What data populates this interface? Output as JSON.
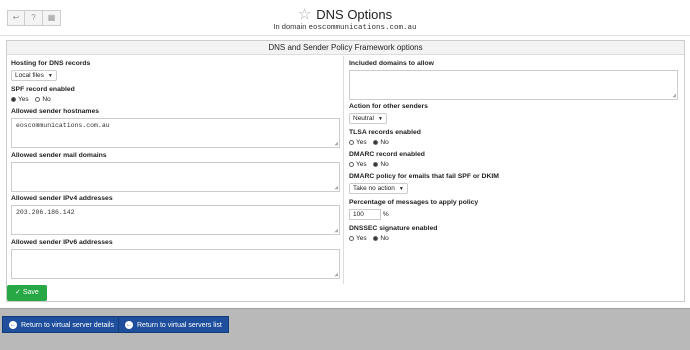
{
  "header": {
    "back_icon": "back-arrow-icon",
    "help_icon": "help-icon",
    "grid_icon": "grid-icon",
    "title": "DNS Options",
    "subtitle_prefix": "In domain ",
    "domain": "eoscommunications.com.au"
  },
  "panel": {
    "heading": "DNS and Sender Policy Framework options"
  },
  "left": {
    "hosting": {
      "label": "Hosting for DNS records",
      "value": "Local files"
    },
    "spf": {
      "label": "SPF record enabled",
      "yes": "Yes",
      "no": "No",
      "selected": "Yes"
    },
    "hostnames": {
      "label": "Allowed sender hostnames",
      "value": "eoscommunications.com.au"
    },
    "mail_domains": {
      "label": "Allowed sender mail domains",
      "value": ""
    },
    "ipv4": {
      "label": "Allowed sender IPv4 addresses",
      "value": "203.206.186.142"
    },
    "ipv6": {
      "label": "Allowed sender IPv6 addresses",
      "value": ""
    }
  },
  "right": {
    "included": {
      "label": "Included domains to allow",
      "value": ""
    },
    "other_senders": {
      "label": "Action for other senders",
      "value": "Neutral"
    },
    "tlsa": {
      "label": "TLSA records enabled",
      "yes": "Yes",
      "no": "No",
      "selected": "No"
    },
    "dmarc": {
      "label": "DMARC record enabled",
      "yes": "Yes",
      "no": "No",
      "selected": "No"
    },
    "dmarc_policy": {
      "label": "DMARC policy for emails that fail SPF or DKIM",
      "value": "Take no action"
    },
    "percentage": {
      "label": "Percentage of messages to apply policy",
      "value": "100",
      "unit": "%"
    },
    "dnssec": {
      "label": "DNSSEC signature enabled",
      "yes": "Yes",
      "no": "No",
      "selected": "No"
    }
  },
  "actions": {
    "save": "Save"
  },
  "footer": {
    "return_details": "Return to virtual server details",
    "return_list": "Return to virtual servers list"
  },
  "colors": {
    "save_green": "#28a745",
    "nav_blue": "#1f4f9c",
    "footer_gray": "#b9b9b9"
  }
}
